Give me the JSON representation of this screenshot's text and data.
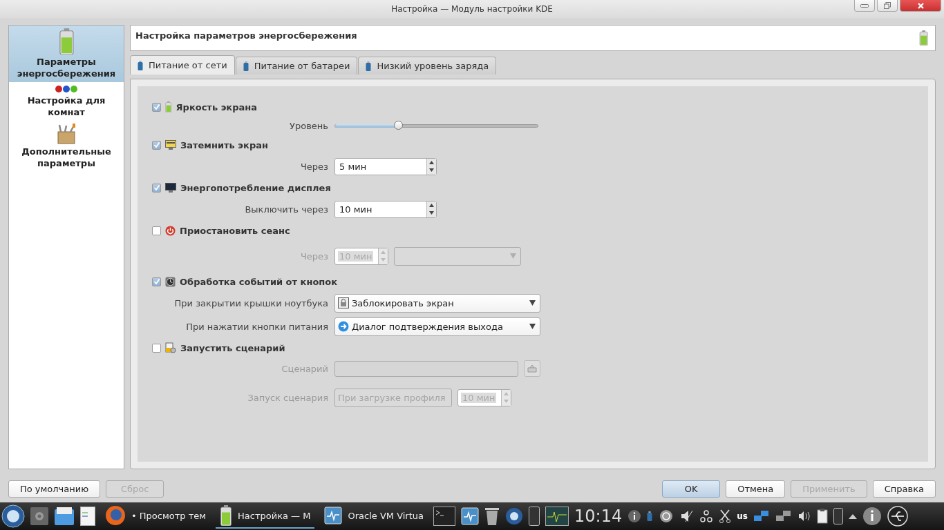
{
  "window": {
    "title": "Настройка — Модуль настройки KDE"
  },
  "sidebar": {
    "items": [
      {
        "label": "Параметры энергосбережения",
        "selected": true
      },
      {
        "label": "Настройка для комнат",
        "selected": false
      },
      {
        "label": "Дополнительные параметры",
        "selected": false
      }
    ]
  },
  "header": {
    "title": "Настройка параметров энергосбережения"
  },
  "tabs": [
    {
      "label": "Питание от сети",
      "selected": true
    },
    {
      "label": "Питание от батареи",
      "selected": false
    },
    {
      "label": "Низкий уровень заряда",
      "selected": false
    }
  ],
  "sections": [
    {
      "label": "Яркость экрана",
      "checked": true,
      "rows": [
        {
          "kind": "slider",
          "label": "Уровень",
          "level": 0.31,
          "disabled": false
        }
      ]
    },
    {
      "label": "Затемнить экран",
      "checked": true,
      "rows": [
        {
          "kind": "spin",
          "label": "Через",
          "value": "5 мин",
          "disabled": false
        }
      ]
    },
    {
      "label": "Энергопотребление дисплея",
      "checked": true,
      "rows": [
        {
          "kind": "spin",
          "label": "Выключить через",
          "value": "10 мин",
          "disabled": false
        }
      ]
    },
    {
      "label": "Приостановить сеанс",
      "checked": false,
      "rows": [
        {
          "kind": "spin_combo",
          "label": "Через",
          "value": "10 мин",
          "disabled": true
        }
      ]
    },
    {
      "label": "Обработка событий от кнопок",
      "checked": true,
      "rows": [
        {
          "kind": "combo",
          "label": "При закрытии крышки ноутбука",
          "value": "Заблокировать экран",
          "disabled": false
        },
        {
          "kind": "combo",
          "label": "При нажатии кнопки питания",
          "value": "Диалог подтверждения выхода",
          "disabled": false
        }
      ]
    },
    {
      "label": "Запустить сценарий",
      "checked": false,
      "rows": [
        {
          "kind": "file",
          "label": "Сценарий",
          "disabled": true
        },
        {
          "kind": "combo_spin",
          "label": "Запуск сценария",
          "value": "При загрузке профиля",
          "spin_value": "10 мин",
          "disabled": true
        }
      ]
    }
  ],
  "buttons_left": [
    {
      "label": "По умолчанию",
      "disabled": false
    },
    {
      "label": "Сброс",
      "disabled": true
    }
  ],
  "buttons_right": [
    {
      "label": "OK",
      "disabled": false,
      "default": true
    },
    {
      "label": "Отмена",
      "disabled": false,
      "default": false
    },
    {
      "label": "Применить",
      "disabled": true,
      "default": false
    },
    {
      "label": "Справка",
      "disabled": false,
      "default": false
    }
  ],
  "taskbar": {
    "tasks": [
      {
        "label": "• Просмотр тем",
        "active": false
      },
      {
        "label": "Настройка — М",
        "active": true
      },
      {
        "label": "Oracle VM Virtua",
        "active": false
      }
    ],
    "clock": "10:14",
    "keyboard": "us"
  }
}
